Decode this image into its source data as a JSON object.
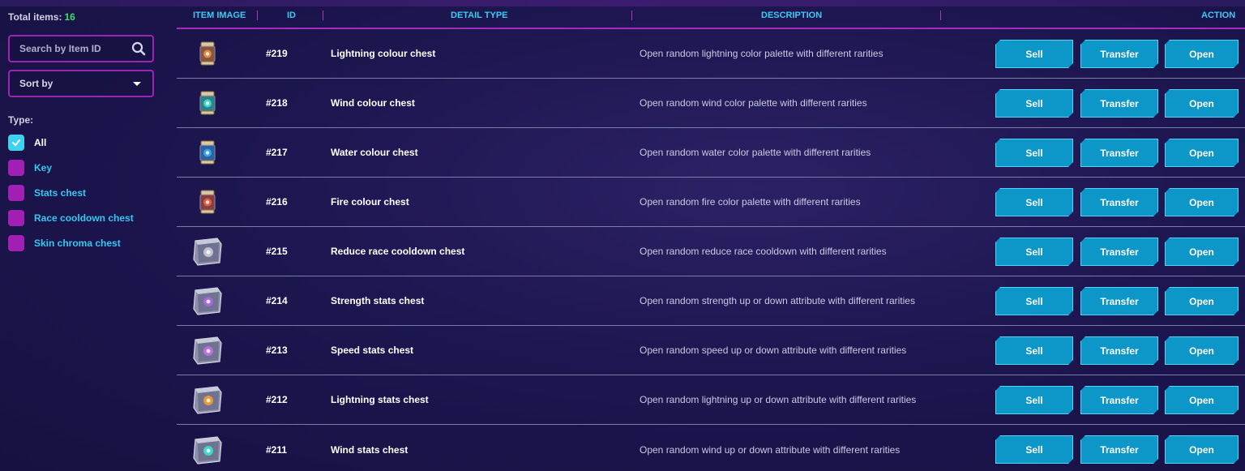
{
  "sidebar": {
    "total_label": "Total items:",
    "total_count": "16",
    "search_placeholder": "Search by Item ID",
    "sort_label": "Sort by",
    "type_label": "Type:",
    "filters": [
      {
        "label": "All",
        "checked": true
      },
      {
        "label": "Key",
        "checked": false
      },
      {
        "label": "Stats chest",
        "checked": false
      },
      {
        "label": "Race cooldown chest",
        "checked": false
      },
      {
        "label": "Skin chroma chest",
        "checked": false
      }
    ]
  },
  "table": {
    "headers": {
      "image": "ITEM IMAGE",
      "id": "ID",
      "detail": "DETAIL TYPE",
      "description": "DESCRIPTION",
      "action": "ACTION"
    },
    "buttons": {
      "sell": "Sell",
      "transfer": "Transfer",
      "open": "Open"
    },
    "rows": [
      {
        "id": "#219",
        "detail": "Lightning colour chest",
        "description": "Open random lightning color palette with different rarities",
        "icon": "jar-icon",
        "color": "#e08a3a"
      },
      {
        "id": "#218",
        "detail": "Wind colour chest",
        "description": "Open random wind color palette with different rarities",
        "icon": "jar-icon",
        "color": "#3ed6c0"
      },
      {
        "id": "#217",
        "detail": "Water colour chest",
        "description": "Open random water color palette with different rarities",
        "icon": "jar-icon",
        "color": "#3aa0e8"
      },
      {
        "id": "#216",
        "detail": "Fire colour chest",
        "description": "Open random fire color palette with different rarities",
        "icon": "jar-icon",
        "color": "#e0603a"
      },
      {
        "id": "#215",
        "detail": "Reduce race cooldown chest",
        "description": "Open random reduce race cooldown with different rarities",
        "icon": "cube-icon",
        "color": "#c9cbd8"
      },
      {
        "id": "#214",
        "detail": "Strength stats chest",
        "description": "Open random strength up or down attribute with different rarities",
        "icon": "cube-icon",
        "color": "#a86ae0"
      },
      {
        "id": "#213",
        "detail": "Speed stats chest",
        "description": "Open random speed up or down attribute with different rarities",
        "icon": "cube-icon",
        "color": "#c070e8"
      },
      {
        "id": "#212",
        "detail": "Lightning stats chest",
        "description": "Open random lightning up or down attribute with different rarities",
        "icon": "cube-icon",
        "color": "#f0a030"
      },
      {
        "id": "#211",
        "detail": "Wind stats chest",
        "description": "Open random wind up or down attribute with different rarities",
        "icon": "cube-icon",
        "color": "#3ee0d0"
      }
    ]
  }
}
